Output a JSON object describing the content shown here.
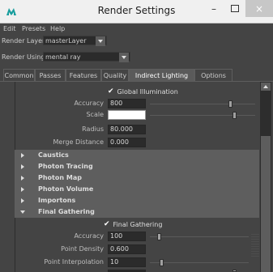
{
  "window": {
    "title": "Render Settings",
    "icon": "maya-app-icon",
    "controls": {
      "minimize": "–",
      "close": "×"
    }
  },
  "menu": {
    "items": [
      "Edit",
      "Presets",
      "Help"
    ]
  },
  "render_layer": {
    "label": "Render Layer",
    "value": "masterLayer"
  },
  "render_using": {
    "label": "Render Using",
    "value": "mental ray"
  },
  "tabs": [
    {
      "label": "Common",
      "active": false
    },
    {
      "label": "Passes",
      "active": false
    },
    {
      "label": "Features",
      "active": false
    },
    {
      "label": "Quality",
      "active": false
    },
    {
      "label": "Indirect Lighting",
      "active": true
    },
    {
      "label": "Options",
      "active": false
    }
  ],
  "global_illumination": {
    "checkbox_label": "Global Illumination",
    "checked": true,
    "accuracy": {
      "label": "Accuracy",
      "value": "800"
    },
    "scale": {
      "label": "Scale",
      "color": "#ffffff"
    },
    "radius": {
      "label": "Radius",
      "value": "80.000"
    },
    "merge_distance": {
      "label": "Merge Distance",
      "value": "0.000"
    }
  },
  "sections": [
    {
      "label": "Caustics",
      "expanded": false
    },
    {
      "label": "Photon Tracing",
      "expanded": false
    },
    {
      "label": "Photon Map",
      "expanded": false
    },
    {
      "label": "Photon Volume",
      "expanded": false
    },
    {
      "label": "Importons",
      "expanded": false
    },
    {
      "label": "Final Gathering",
      "expanded": true
    }
  ],
  "final_gathering": {
    "checkbox_label": "Final Gathering",
    "checked": true,
    "accuracy": {
      "label": "Accuracy",
      "value": "100"
    },
    "point_density": {
      "label": "Point Density",
      "value": "0.600"
    },
    "point_interpolation": {
      "label": "Point Interpolation",
      "value": "10"
    }
  },
  "colors": {
    "panel": "#444444",
    "header": "#5e5e5e",
    "active_tab": "#5a5a5a",
    "titlebar": "#f0f0f0"
  }
}
